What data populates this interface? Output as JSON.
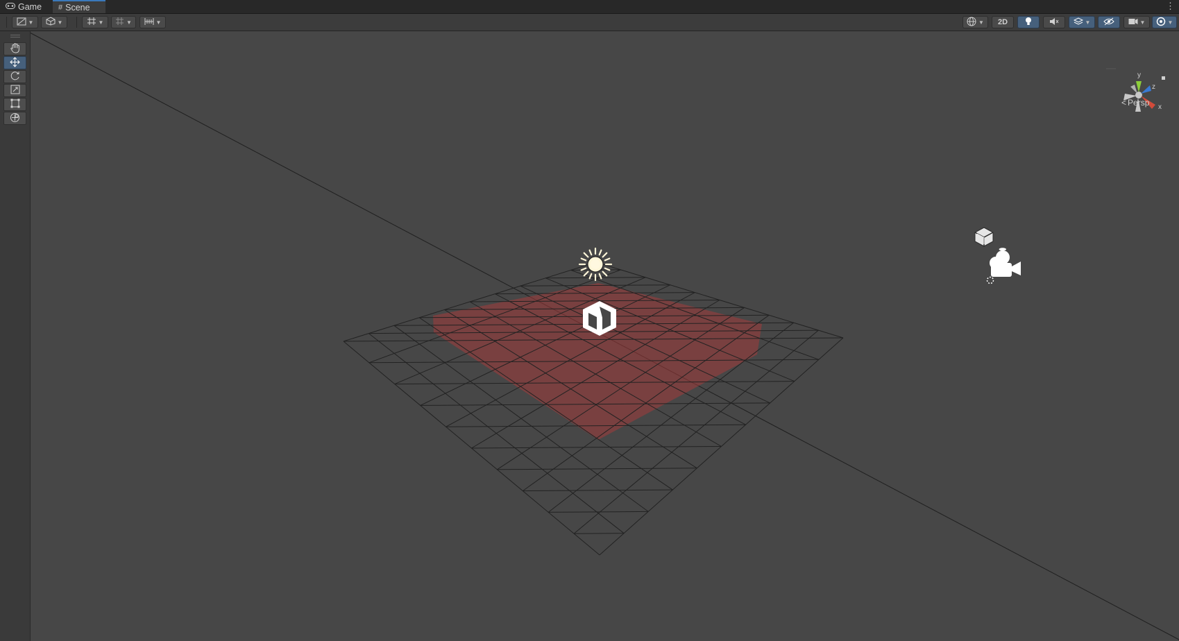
{
  "tabs": [
    {
      "label": "Game",
      "icon": "gamepad-icon"
    },
    {
      "label": "Scene",
      "icon": "grid-hash-icon",
      "active": true
    }
  ],
  "toolbar": {
    "left": [
      {
        "name": "draw-mode-button",
        "icon": "shaded-draw-icon",
        "dropdown": true
      },
      {
        "name": "render-mode-button",
        "icon": "cube-outline-icon",
        "dropdown": true
      },
      {
        "name": "grid-snap-button",
        "icon": "grid-snap-icon",
        "dropdown": true
      },
      {
        "name": "increment-snap-button",
        "icon": "increment-snap-icon",
        "dropdown": true
      },
      {
        "name": "ruler-button",
        "icon": "ruler-icon",
        "dropdown": true
      }
    ],
    "right": [
      {
        "name": "global-view-button",
        "icon": "globe-icon",
        "dropdown": true
      },
      {
        "name": "toggle-2d-button",
        "label": "2D"
      },
      {
        "name": "lighting-toggle-button",
        "icon": "lightbulb-icon",
        "active": true
      },
      {
        "name": "audio-toggle-button",
        "icon": "speaker-muted-icon"
      },
      {
        "name": "effects-toggle-button",
        "icon": "layers-effects-icon",
        "dropdown": true,
        "active": true
      },
      {
        "name": "hidden-objects-toggle-button",
        "icon": "eye-hidden-icon",
        "active": true
      },
      {
        "name": "camera-settings-button",
        "icon": "camera-icon",
        "dropdown": true
      },
      {
        "name": "gizmos-toggle-button",
        "icon": "gizmos-icon",
        "dropdown": true,
        "active": true
      }
    ]
  },
  "tools": [
    {
      "name": "hand-tool",
      "icon": "hand-icon"
    },
    {
      "name": "move-tool",
      "icon": "move-arrows-icon",
      "active": true
    },
    {
      "name": "rotate-tool",
      "icon": "rotate-icon"
    },
    {
      "name": "scale-tool",
      "icon": "scale-icon"
    },
    {
      "name": "rect-tool",
      "icon": "rect-transform-icon"
    },
    {
      "name": "transform-tool",
      "icon": "transform-icon"
    }
  ],
  "gizmo": {
    "axis_y": "y",
    "axis_z": "z",
    "axis_x": "x",
    "projection": "Persp",
    "colors": {
      "x": "#d24b3a",
      "y": "#8ccf3a",
      "z": "#3a79d2"
    }
  },
  "scene": {
    "selection_color": "#a23a3a",
    "grid_line_color": "#222222",
    "objects": [
      "sun-light-icon",
      "selected-cube-icon",
      "cube-gizmo-icon",
      "camera-gizmo-icon"
    ]
  }
}
